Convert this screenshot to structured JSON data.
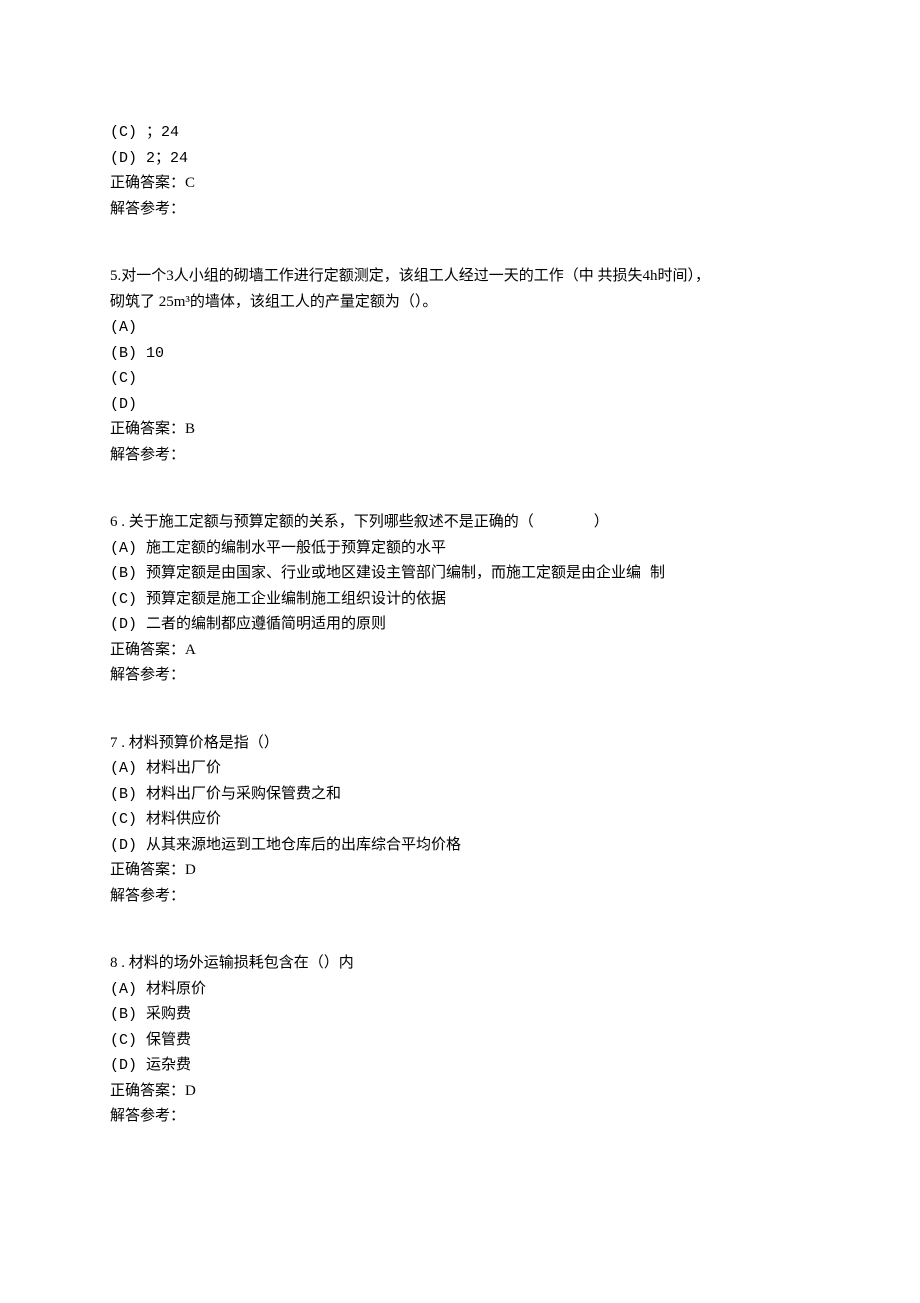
{
  "q4": {
    "optC": "(C) ；24",
    "optD": "(D) 2；24",
    "answer": "正确答案：C",
    "expl": "解答参考："
  },
  "q5": {
    "stem1": "5.对一个3人小组的砌墙工作进行定额测定，该组工人经过一天的工作（中 共损失4h时间），",
    "stem2": "砌筑了 25m³的墙体，该组工人的产量定额为（）。",
    "optA": "(A)",
    "optB": "(B) 10",
    "optC": "(C)",
    "optD": "(D)",
    "answer": "正确答案：B",
    "expl": "解答参考："
  },
  "q6": {
    "stem": "6 . 关于施工定额与预算定额的关系，下列哪些叙述不是正确的（                ）",
    "optA": "(A) 施工定额的编制水平一般低于预算定额的水平",
    "optB": "(B) 预算定额是由国家、行业或地区建设主管部门编制，而施工定额是由企业编 制",
    "optC": "(C) 预算定额是施工企业编制施工组织设计的依据",
    "optD": "(D) 二者的编制都应遵循简明适用的原则",
    "answer": "正确答案：A",
    "expl": "解答参考："
  },
  "q7": {
    "stem": "7 . 材料预算价格是指（）",
    "optA": "(A) 材料出厂价",
    "optB": "(B) 材料出厂价与采购保管费之和",
    "optC": "(C) 材料供应价",
    "optD": "(D) 从其来源地运到工地仓库后的出库综合平均价格",
    "answer": "正确答案：D",
    "expl": "解答参考："
  },
  "q8": {
    "stem": "8 . 材料的场外运输损耗包含在（）内",
    "optA": "(A) 材料原价",
    "optB": "(B) 采购费",
    "optC": "(C) 保管费",
    "optD": "(D) 运杂费",
    "answer": "正确答案：D",
    "expl": "解答参考："
  }
}
